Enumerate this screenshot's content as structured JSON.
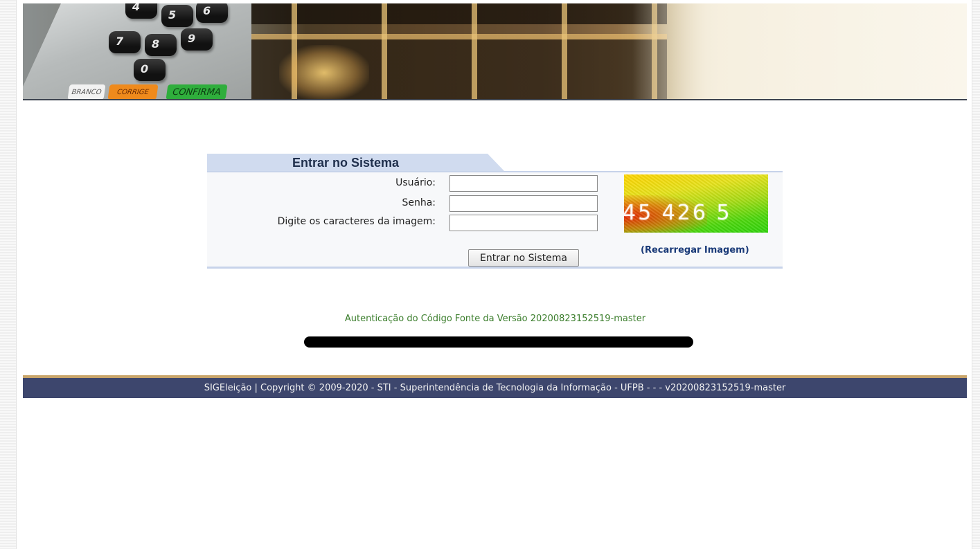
{
  "banner": {
    "keys": [
      "5",
      "6",
      "7",
      "8",
      "9",
      "0"
    ],
    "function_keys": {
      "branco": "BRANCO",
      "corrige": "CORRIGE",
      "confirma": "CONFIRMA"
    }
  },
  "login": {
    "title": "Entrar no Sistema",
    "user_label": "Usuário:",
    "password_label": "Senha:",
    "captcha_label": "Digite os caracteres da imagem:",
    "user_value": "",
    "password_value": "",
    "captcha_value": "",
    "submit_label": "Entrar no Sistema",
    "captcha_text": "45 426 5",
    "reload_label": "(Recarregar Imagem)"
  },
  "version_text": "Autenticação do Código Fonte da Versão 20200823152519-master",
  "footer": {
    "text": "SIGEleição | Copyright © 2009-2020 - STI - Superintendência de Tecnologia da Informação - UFPB - - - v20200823152519-master"
  },
  "colors": {
    "footer_bg": "#3d466d",
    "footer_border": "#c9a56a",
    "tab_bg": "#d0dbef",
    "version_green": "#3a7d2b",
    "link_blue": "#1a3a78"
  }
}
